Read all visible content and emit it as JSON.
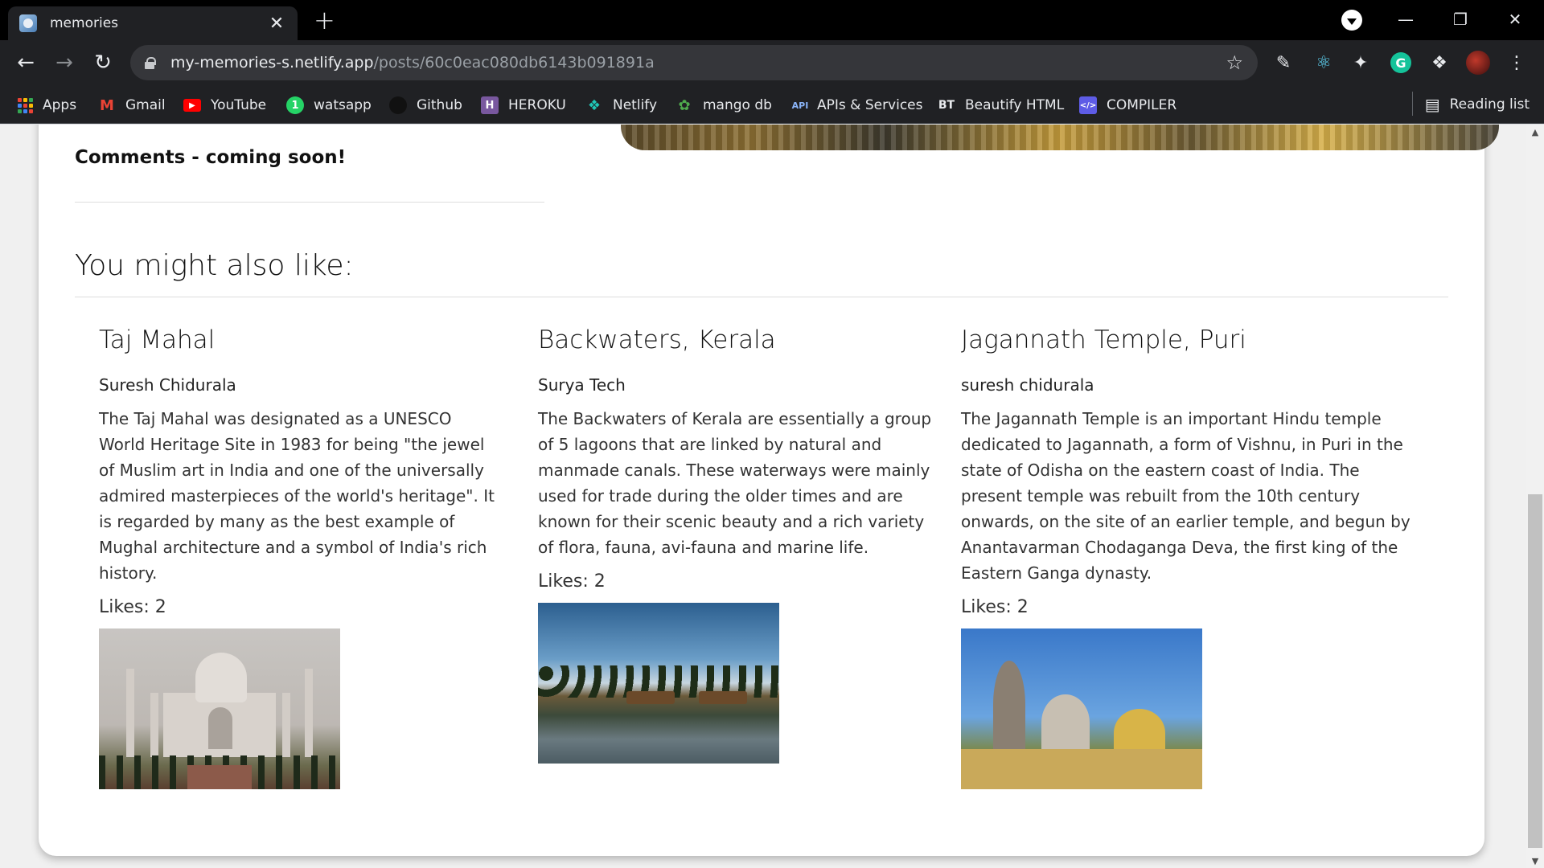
{
  "browser": {
    "tab_title": "memories",
    "tab_close": "✕",
    "new_tab": "+",
    "url_host": "my-memories-s.netlify.app",
    "url_path": "/posts/60c0eac080db6143b091891a",
    "bookmarks": [
      {
        "label": "Apps",
        "icon": "apps-grid-icon"
      },
      {
        "label": "Gmail",
        "icon": "gmail-icon"
      },
      {
        "label": "YouTube",
        "icon": "youtube-icon"
      },
      {
        "label": "watsapp",
        "icon": "whatsapp-icon"
      },
      {
        "label": "Github",
        "icon": "github-icon"
      },
      {
        "label": "HEROKU",
        "icon": "heroku-icon"
      },
      {
        "label": "Netlify",
        "icon": "netlify-icon"
      },
      {
        "label": "mango db",
        "icon": "mongodb-icon"
      },
      {
        "label": "APIs & Services",
        "icon": "api-icon"
      },
      {
        "label": "Beautify HTML",
        "icon": "beautify-icon"
      },
      {
        "label": "COMPILER",
        "icon": "compiler-icon"
      }
    ],
    "reading_list": "Reading list"
  },
  "page": {
    "comments_heading": "Comments - coming soon!",
    "similar_heading": "You might also like:",
    "posts": [
      {
        "title": "Taj Mahal",
        "author": "Suresh Chidurala",
        "message": "The Taj Mahal was designated as a UNESCO World Heritage Site in 1983 for being \"the jewel of Muslim art in India and one of the universally admired masterpieces of the world's heritage\". It is regarded by many as the best example of Mughal architecture and a symbol of India's rich history.",
        "likes": "Likes: 2"
      },
      {
        "title": "Backwaters, Kerala",
        "author": "Surya Tech",
        "message": "The Backwaters of Kerala are essentially a group of 5 lagoons that are linked by natural and manmade canals. These waterways were mainly used for trade during the older times and are known for their scenic beauty and a rich variety of flora, fauna, avi-fauna and marine life.",
        "likes": "Likes: 2"
      },
      {
        "title": "Jagannath Temple, Puri",
        "author": "suresh chidurala",
        "message": "The Jagannath Temple is an important Hindu temple dedicated to Jagannath, a form of Vishnu, in Puri in the state of Odisha on the eastern coast of India. The present temple was rebuilt from the 10th century onwards, on the site of an earlier temple, and begun by Anantavarman Chodaganga Deva, the first king of the Eastern Ganga dynasty.",
        "likes": "Likes: 2"
      }
    ]
  }
}
